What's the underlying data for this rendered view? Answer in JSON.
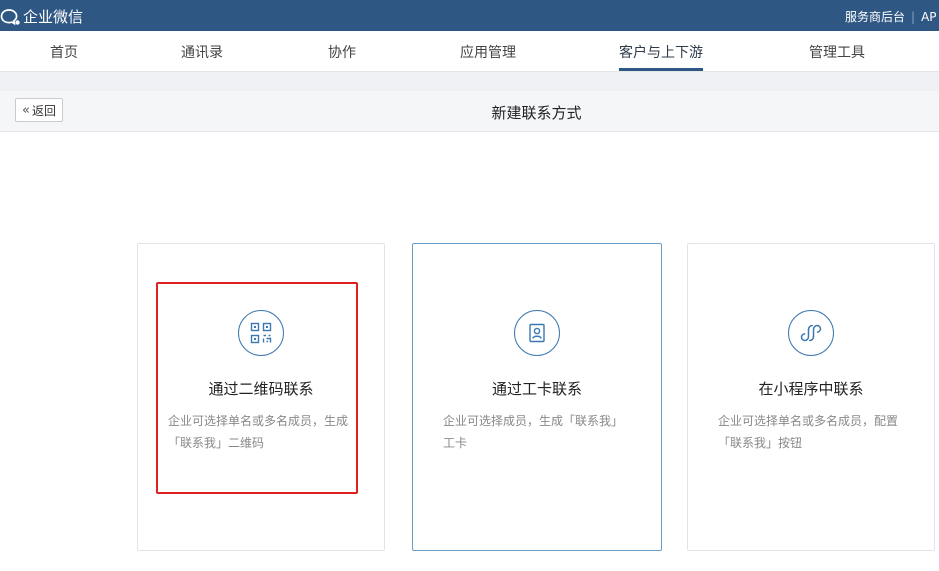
{
  "topbar": {
    "brand": "企业微信",
    "service_backend": "服务商后台",
    "api_partial": "AP"
  },
  "nav": {
    "items": [
      {
        "label": "首页"
      },
      {
        "label": "通讯录"
      },
      {
        "label": "协作"
      },
      {
        "label": "应用管理"
      },
      {
        "label": "客户与上下游",
        "active": true
      },
      {
        "label": "管理工具"
      }
    ]
  },
  "subheader": {
    "back_label": "返回",
    "title": "新建联系方式"
  },
  "cards": [
    {
      "icon": "qrcode-icon",
      "title": "通过二维码联系",
      "desc_line1": "企业可选择单名或多名成员，生成",
      "desc_line2": "「联系我」二维码"
    },
    {
      "icon": "badge-card-icon",
      "title": "通过工卡联系",
      "desc_line1": "企业可选择成员，生成「联系我」",
      "desc_line2": "工卡"
    },
    {
      "icon": "miniprogram-icon",
      "title": "在小程序中联系",
      "desc_line1": "企业可选择单名或多名成员，配置",
      "desc_line2": "「联系我」按钮"
    }
  ],
  "colors": {
    "topbar": "#2f5783",
    "accent": "#3d78b0",
    "highlight": "#e02020"
  }
}
